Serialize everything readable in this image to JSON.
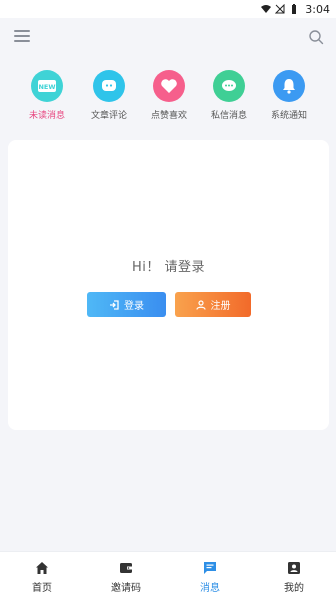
{
  "status_bar": {
    "time": "3:04"
  },
  "app_bar": {
    "menu_icon": "menu-icon",
    "search_icon": "search-icon"
  },
  "categories": [
    {
      "label": "未读消息",
      "icon": "new-badge-icon",
      "color": "#3fd3d6",
      "active": true,
      "badge_text": "NEW"
    },
    {
      "label": "文章评论",
      "icon": "comment-bubble-icon",
      "color": "#2fc4ea",
      "active": false
    },
    {
      "label": "点赞喜欢",
      "icon": "heart-icon",
      "color": "#f65f8c",
      "active": false
    },
    {
      "label": "私信消息",
      "icon": "chat-dots-icon",
      "color": "#3fcf95",
      "active": false
    },
    {
      "label": "系统通知",
      "icon": "bell-icon",
      "color": "#3b9af2",
      "active": false
    }
  ],
  "login_card": {
    "greeting": "Hi！ 请登录",
    "login_label": "登录",
    "register_label": "注册"
  },
  "tabs": [
    {
      "label": "首页",
      "icon": "home-icon",
      "active": false
    },
    {
      "label": "邀请码",
      "icon": "wallet-icon",
      "active": false
    },
    {
      "label": "消息",
      "icon": "message-icon",
      "active": true
    },
    {
      "label": "我的",
      "icon": "profile-icon",
      "active": false
    }
  ],
  "colors": {
    "accent": "#2e8fe6",
    "active_category": "#e8457f",
    "background": "#f4f5f9"
  }
}
